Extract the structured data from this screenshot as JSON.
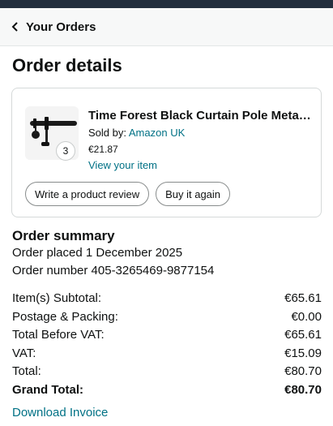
{
  "header": {
    "back_label": "Your Orders"
  },
  "page": {
    "title": "Order details"
  },
  "item": {
    "title": "Time Forest Black Curtain Pole Meta…",
    "sold_by_label": "Sold by:",
    "seller": "Amazon UK",
    "price": "€21.87",
    "quantity": "3",
    "view_item": "View your item",
    "buttons": {
      "review": "Write a product review",
      "buy_again": "Buy it again"
    }
  },
  "summary": {
    "title": "Order summary",
    "placed": "Order placed 1 December 2025",
    "order_number": "Order number 405-3265469-9877154",
    "rows": [
      {
        "label": "Item(s) Subtotal:",
        "value": "€65.61"
      },
      {
        "label": "Postage & Packing:",
        "value": "€0.00"
      },
      {
        "label": "Total Before VAT:",
        "value": "€65.61"
      },
      {
        "label": "VAT:",
        "value": "€15.09"
      },
      {
        "label": "Total:",
        "value": "€80.70"
      },
      {
        "label": "Grand Total:",
        "value": "€80.70"
      }
    ],
    "download": "Download Invoice"
  },
  "colors": {
    "link": "#007185",
    "top_bar": "#232f3e",
    "text": "#0f1111"
  }
}
